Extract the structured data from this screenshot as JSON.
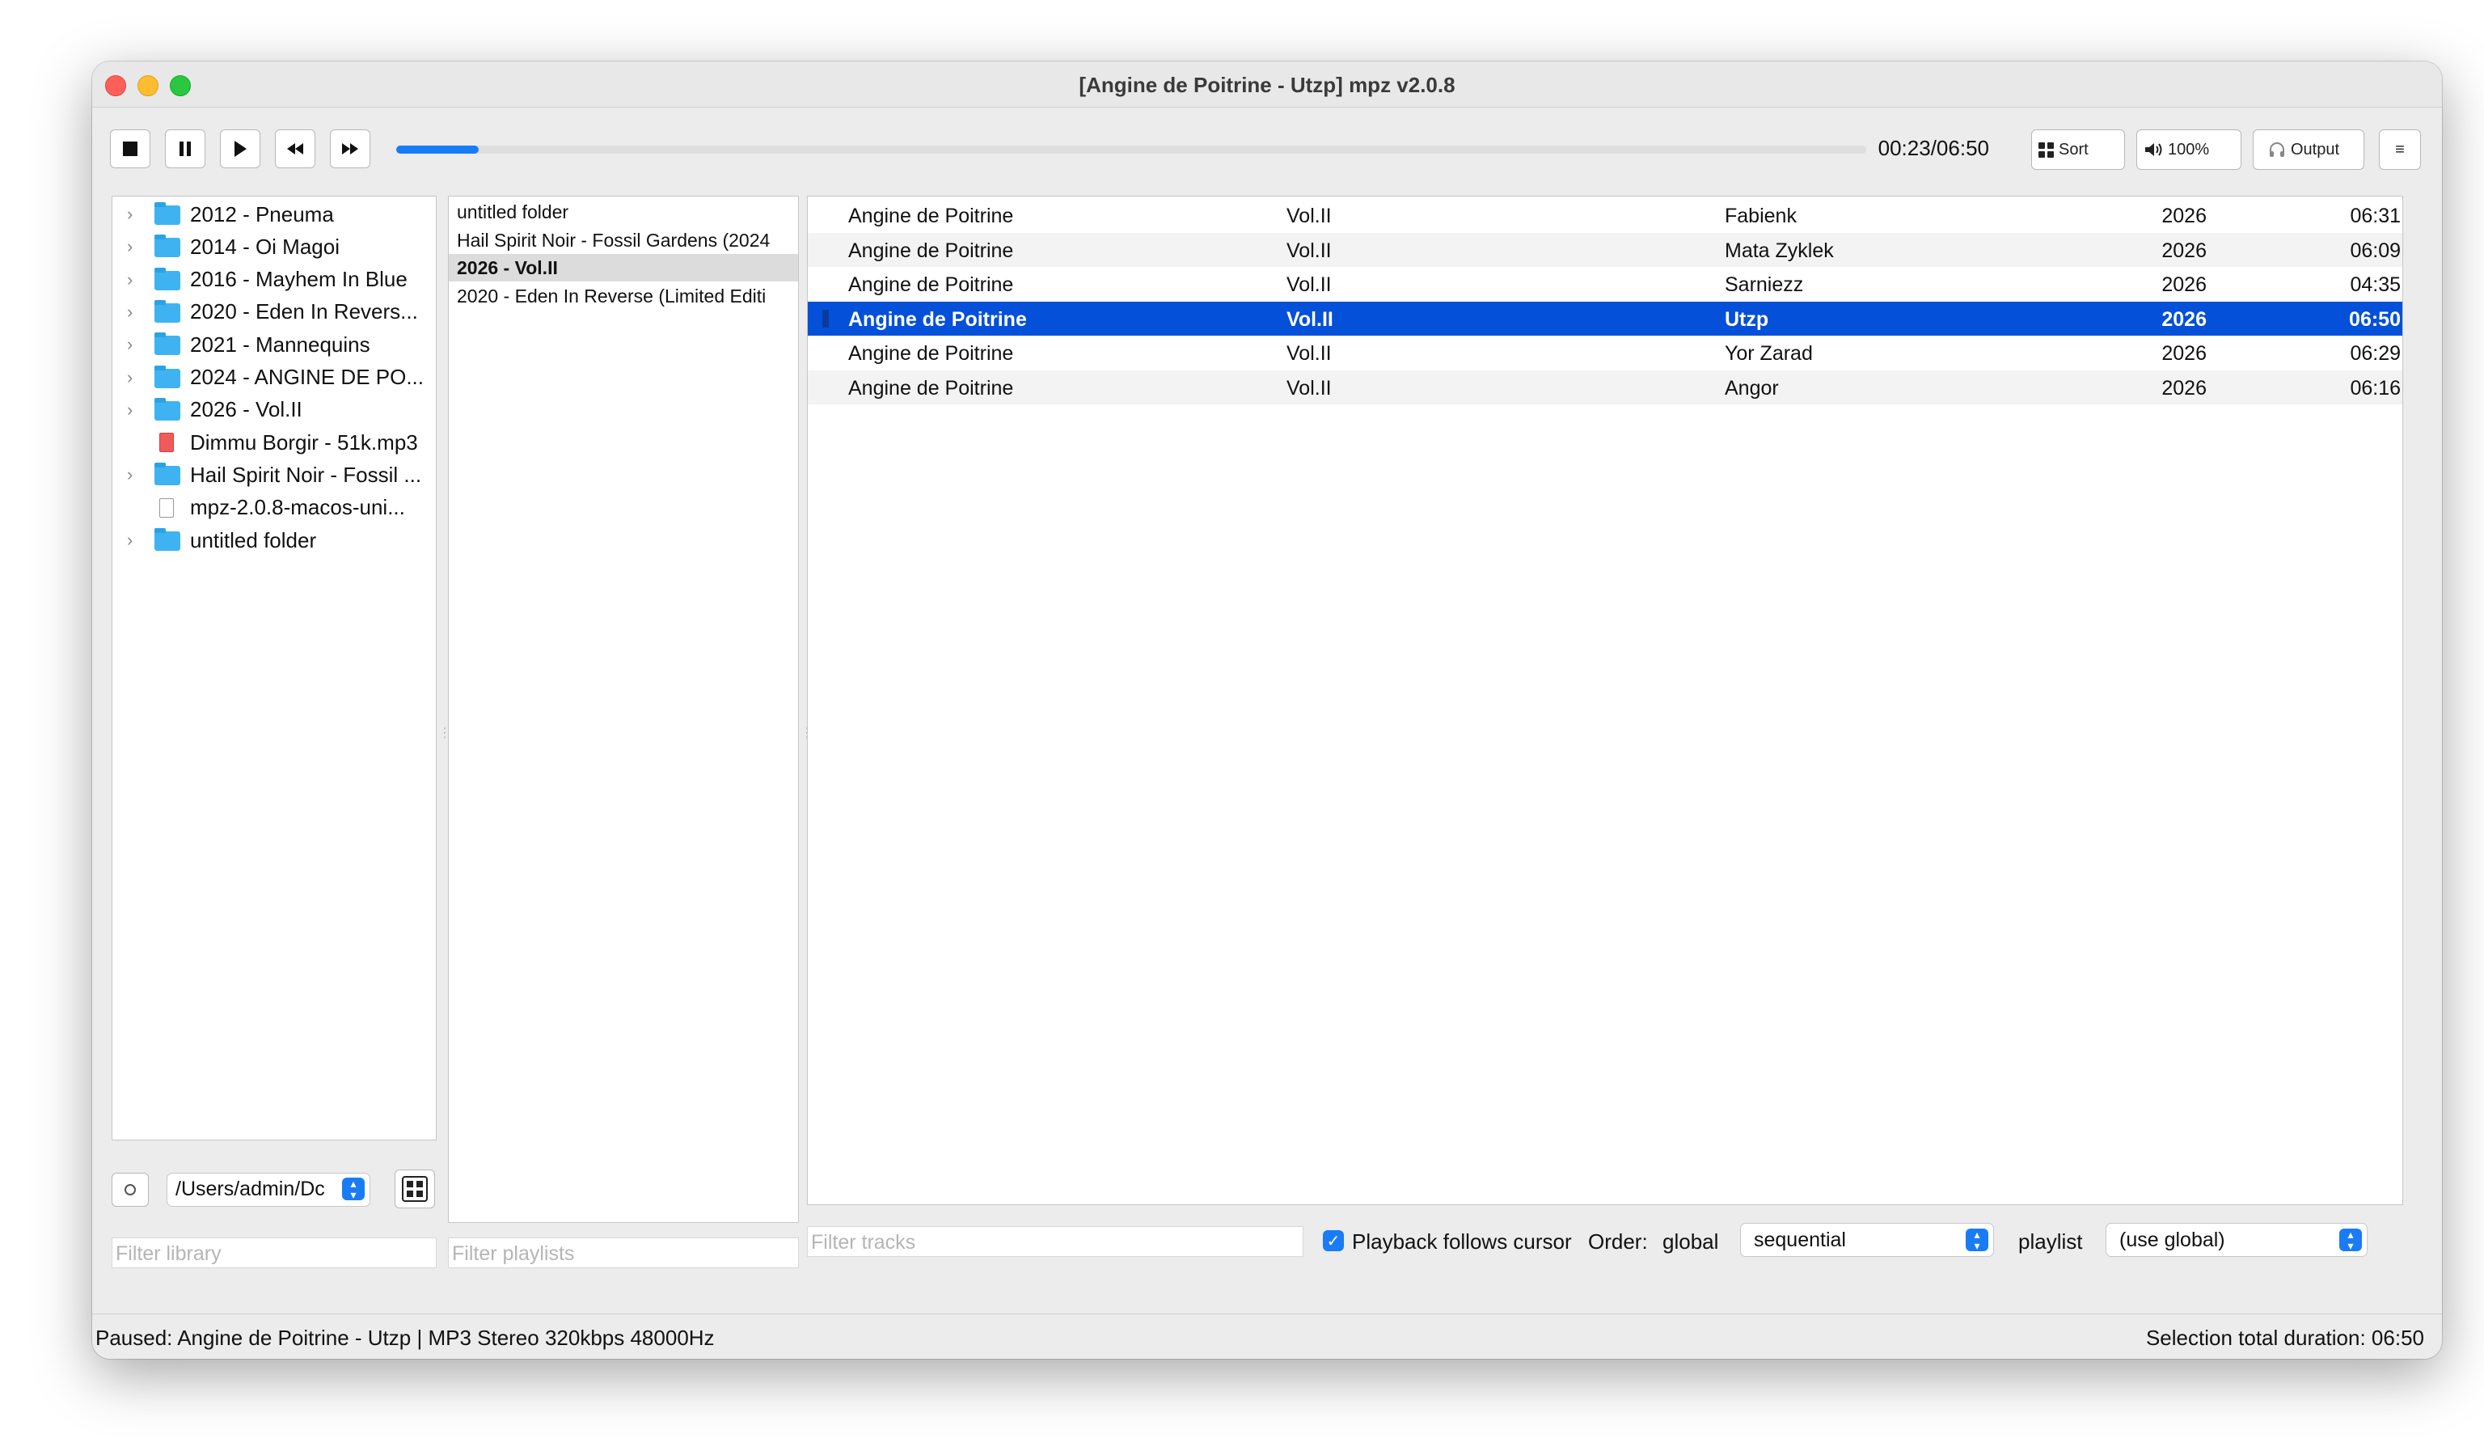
{
  "window": {
    "title": "[Angine de Poitrine - Utzp] mpz v2.0.8"
  },
  "toolbar": {
    "stop_icon": "stop-icon",
    "pause_icon": "pause-icon",
    "play_icon": "play-icon",
    "prev_icon": "rewind-icon",
    "next_icon": "fast-forward-icon",
    "progress": 0.056,
    "time": "00:23/06:50",
    "sort_label": "Sort",
    "volume_label": "100%",
    "output_label": "Output",
    "menu_label": "≡"
  },
  "library": {
    "items": [
      {
        "label": "2012 - Pneuma",
        "type": "folder"
      },
      {
        "label": "2014 - Oi Magoi",
        "type": "folder"
      },
      {
        "label": "2016 - Mayhem In Blue",
        "type": "folder"
      },
      {
        "label": "2020 - Eden In Revers...",
        "type": "folder"
      },
      {
        "label": "2021 - Mannequins",
        "type": "folder"
      },
      {
        "label": "2024 - ANGINE DE PO...",
        "type": "folder"
      },
      {
        "label": "2026 - Vol.II",
        "type": "folder"
      },
      {
        "label": "Dimmu Borgir - 51k.mp3",
        "type": "mp3"
      },
      {
        "label": "Hail Spirit Noir - Fossil ...",
        "type": "folder"
      },
      {
        "label": "mpz-2.0.8-macos-uni...",
        "type": "file"
      },
      {
        "label": "untitled folder",
        "type": "folder"
      }
    ],
    "path": "/Users/admin/Dc",
    "filter_placeholder": "Filter library"
  },
  "playlists": {
    "items": [
      {
        "label": "untitled folder",
        "selected": false
      },
      {
        "label": "Hail Spirit Noir - Fossil Gardens (2024",
        "selected": false
      },
      {
        "label": "2026 - Vol.II",
        "selected": true
      },
      {
        "label": "2020 - Eden In Reverse (Limited Editi",
        "selected": false
      }
    ],
    "filter_placeholder": "Filter playlists"
  },
  "tracks": {
    "rows": [
      {
        "artist": "Angine de Poitrine",
        "album": "Vol.II",
        "title": "Fabienk",
        "year": "2026",
        "duration": "06:31",
        "selected": false
      },
      {
        "artist": "Angine de Poitrine",
        "album": "Vol.II",
        "title": "Mata Zyklek",
        "year": "2026",
        "duration": "06:09",
        "selected": false
      },
      {
        "artist": "Angine de Poitrine",
        "album": "Vol.II",
        "title": "Sarniezz",
        "year": "2026",
        "duration": "04:35",
        "selected": false
      },
      {
        "artist": "Angine de Poitrine",
        "album": "Vol.II",
        "title": "Utzp",
        "year": "2026",
        "duration": "06:50",
        "selected": true
      },
      {
        "artist": "Angine de Poitrine",
        "album": "Vol.II",
        "title": "Yor Zarad",
        "year": "2026",
        "duration": "06:29",
        "selected": false
      },
      {
        "artist": "Angine de Poitrine",
        "album": "Vol.II",
        "title": "Angor",
        "year": "2026",
        "duration": "06:16",
        "selected": false
      }
    ],
    "filter_placeholder": "Filter tracks"
  },
  "controls": {
    "follows_cursor_label": "Playback follows cursor",
    "order_label": "Order:",
    "global_label": "global",
    "global_value": "sequential",
    "playlist_label": "playlist",
    "playlist_value": "(use global)"
  },
  "status": {
    "left": "Paused: Angine de Poitrine - Utzp | MP3 Stereo 320kbps 48000Hz",
    "right": "Selection total duration: 06:50"
  },
  "colors": {
    "accent": "#1a7cf5",
    "selection": "#0450d8"
  }
}
